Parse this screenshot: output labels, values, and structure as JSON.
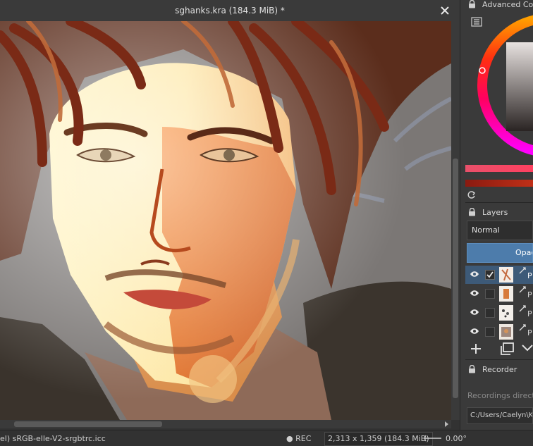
{
  "window": {
    "title": "sghanks.kra (184.3 MiB) *"
  },
  "panels": {
    "color": {
      "title": "Advanced Colo"
    },
    "layers": {
      "title": "Layers",
      "blend_mode": "Normal",
      "opacity_label": "Opac",
      "rows": [
        {
          "name": "P",
          "visible": true,
          "checked": true,
          "selected": true
        },
        {
          "name": "P",
          "visible": true,
          "checked": false,
          "selected": false
        },
        {
          "name": "P",
          "visible": true,
          "checked": false,
          "selected": false
        },
        {
          "name": "P",
          "visible": true,
          "checked": false,
          "selected": false
        }
      ]
    },
    "recorder": {
      "title": "Recorder",
      "directory_label": "Recordings directo",
      "directory_path": "C:/Users/Caelyn\\K"
    }
  },
  "status": {
    "profile": "el)  sRGB-elle-V2-srgbtrc.icc",
    "rec": "● REC",
    "image_size": "2,313 x 1,359 (184.3 MiB)",
    "rotation": "0.00°"
  },
  "colors": {
    "accent": "#4d7cab",
    "selected_layer": "#3d5a78",
    "panel_bg": "#3a3a3a",
    "canvas_bg": "#7a7676"
  }
}
